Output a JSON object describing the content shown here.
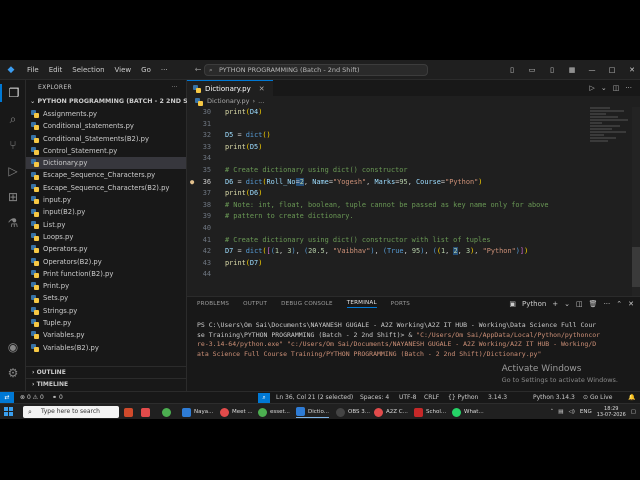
{
  "titlebar": {
    "menus": [
      "File",
      "Edit",
      "Selection",
      "View",
      "Go",
      "···"
    ],
    "command_center": "PYTHON PROGRAMMING (Batch - 2nd Shift)"
  },
  "explorer": {
    "header": "EXPLORER",
    "folder": "PYTHON PROGRAMMING (BATCH - 2 2ND SHIFT)",
    "files": [
      "Assignments.py",
      "Conditional_statements.py",
      "Conditional_Statements(B2).py",
      "Control_Statement.py",
      "Dictionary.py",
      "Escape_Sequence_Characters.py",
      "Escape_Sequence_Characters(B2).py",
      "input.py",
      "input(B2).py",
      "List.py",
      "Loops.py",
      "Operators.py",
      "Operators(B2).py",
      "Print function(B2).py",
      "Print.py",
      "Sets.py",
      "Strings.py",
      "Tuple.py",
      "Variables.py",
      "Variables(B2).py"
    ],
    "outline": "OUTLINE",
    "timeline": "TIMELINE"
  },
  "editor": {
    "tab_label": "Dictionary.py",
    "breadcrumb": "Dictionary.py",
    "breadcrumb_more": "...",
    "line_numbers": [
      "30",
      "31",
      "32",
      "33",
      "34",
      "35",
      "36",
      "37",
      "38",
      "39",
      "40",
      "41",
      "42",
      "43",
      "44"
    ],
    "code": {
      "l30_print": "print",
      "l30_arg": "D4",
      "l32_var": "D5",
      "l32_func": "dict",
      "l33_print": "print",
      "l33_arg": "D5",
      "l35_comment": "# Create dictionary using dict() constructor",
      "l36_var": "D6",
      "l36_func": "dict",
      "l36_k1": "Roll_No",
      "l36_v1": "2",
      "l36_k2": "Name",
      "l36_v2": "\"Yogesh\"",
      "l36_k3": "Marks",
      "l36_v3": "95",
      "l36_k4": "Course",
      "l36_v4": "\"Python\"",
      "l37_print": "print",
      "l37_arg": "D6",
      "l38_comment": "# Note: int, float, boolean, tuple cannot be passed as key name only for above",
      "l39_comment": "# pattern to create dictionary.",
      "l41_comment": "# Create dictionary using dict() constructor with list of tuples",
      "l42_var": "D7",
      "l42_func": "dict",
      "l42_n1": "1",
      "l42_n2": "3",
      "l42_n3": "20.5",
      "l42_s1": "\"Vaibhav\"",
      "l42_b1": "True",
      "l42_n4": "95",
      "l42_n5": "1",
      "l42_n6": "2",
      "l42_n7": "3",
      "l42_s2": "\"Python\"",
      "l43_print": "print",
      "l43_arg": "D7"
    }
  },
  "panel": {
    "tabs": [
      "PROBLEMS",
      "OUTPUT",
      "DEBUG CONSOLE",
      "TERMINAL",
      "PORTS"
    ],
    "active_tab": "TERMINAL",
    "terminal_name": "Python",
    "terminal_lines": [
      "PS C:\\Users\\Om Sai\\Documents\\NAYANESH GUGALE - A2Z Working\\A2Z IT HUB - Working\\Data Science Full Cour",
      "se Training\\PYTHON PROGRAMMING (Batch - 2 2nd Shift)> & ",
      "\"C:/Users/Om Sai/AppData/Local/Python/pythoncor",
      "re-3.14-64/python.exe\" ",
      "\"c:/Users/Om Sai/Documents/NAYANESH GUGALE - A2Z Working/A2Z IT HUB - Working/D",
      "ata Science Full Course Training/PYTHON PROGRAMMING (Batch - 2 2nd Shift)/Dictionary.py\""
    ],
    "activate_title": "Activate Windows",
    "activate_sub": "Go to Settings to activate Windows."
  },
  "statusbar": {
    "errors": "0",
    "warnings": "0",
    "warnings2": "0",
    "position": "Ln 36, Col 21 (2 selected)",
    "spaces": "Spaces: 4",
    "encoding": "UTF-8",
    "eol": "CRLF",
    "language": "Python",
    "version": "3.14.3",
    "interpreter": "Python 3.14.3",
    "golive": "Go Live"
  },
  "taskbar": {
    "search_placeholder": "Type here to search",
    "apps": [
      "Naya...",
      "Meet ...",
      "esset...",
      "Dictio...",
      "OBS 3...",
      "A2Z C...",
      "Schol...",
      "What..."
    ],
    "lang": "ENG",
    "time": "18:29",
    "date": "13-07-2026"
  },
  "colors": {
    "accent": "#0078d4",
    "editor_bg": "#1f1f1f",
    "sidebar_bg": "#181818",
    "string": "#ce9178",
    "comment": "#6a9955",
    "keyword_var": "#9cdcfe",
    "function": "#dcdcaa"
  }
}
